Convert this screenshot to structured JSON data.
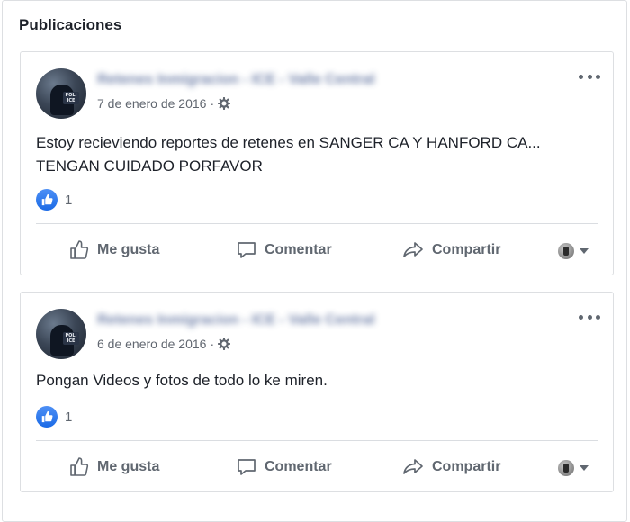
{
  "section": {
    "title": "Publicaciones"
  },
  "colors": {
    "like_blue": "#1a6ae6",
    "text": "#1d2129",
    "muted": "#606770",
    "border": "#dddfe2"
  },
  "posts": [
    {
      "author": "Retenes Inmigracion - ICE - Valle Central",
      "date": "7 de enero de 2016",
      "separator": "·",
      "privacy_icon": "gear-icon",
      "text": "Estoy recieviendo reportes de retenes en SANGER CA Y HANFORD CA... TENGAN CUIDADO PORFAVOR",
      "like_count": "1",
      "actions": {
        "like": "Me gusta",
        "comment": "Comentar",
        "share": "Compartir"
      }
    },
    {
      "author": "Retenes Inmigracion - ICE - Valle Central",
      "date": "6 de enero de 2016",
      "separator": "·",
      "privacy_icon": "gear-icon",
      "text": "Pongan Videos y fotos de todo lo ke miren.",
      "like_count": "1",
      "actions": {
        "like": "Me gusta",
        "comment": "Comentar",
        "share": "Compartir"
      }
    }
  ]
}
